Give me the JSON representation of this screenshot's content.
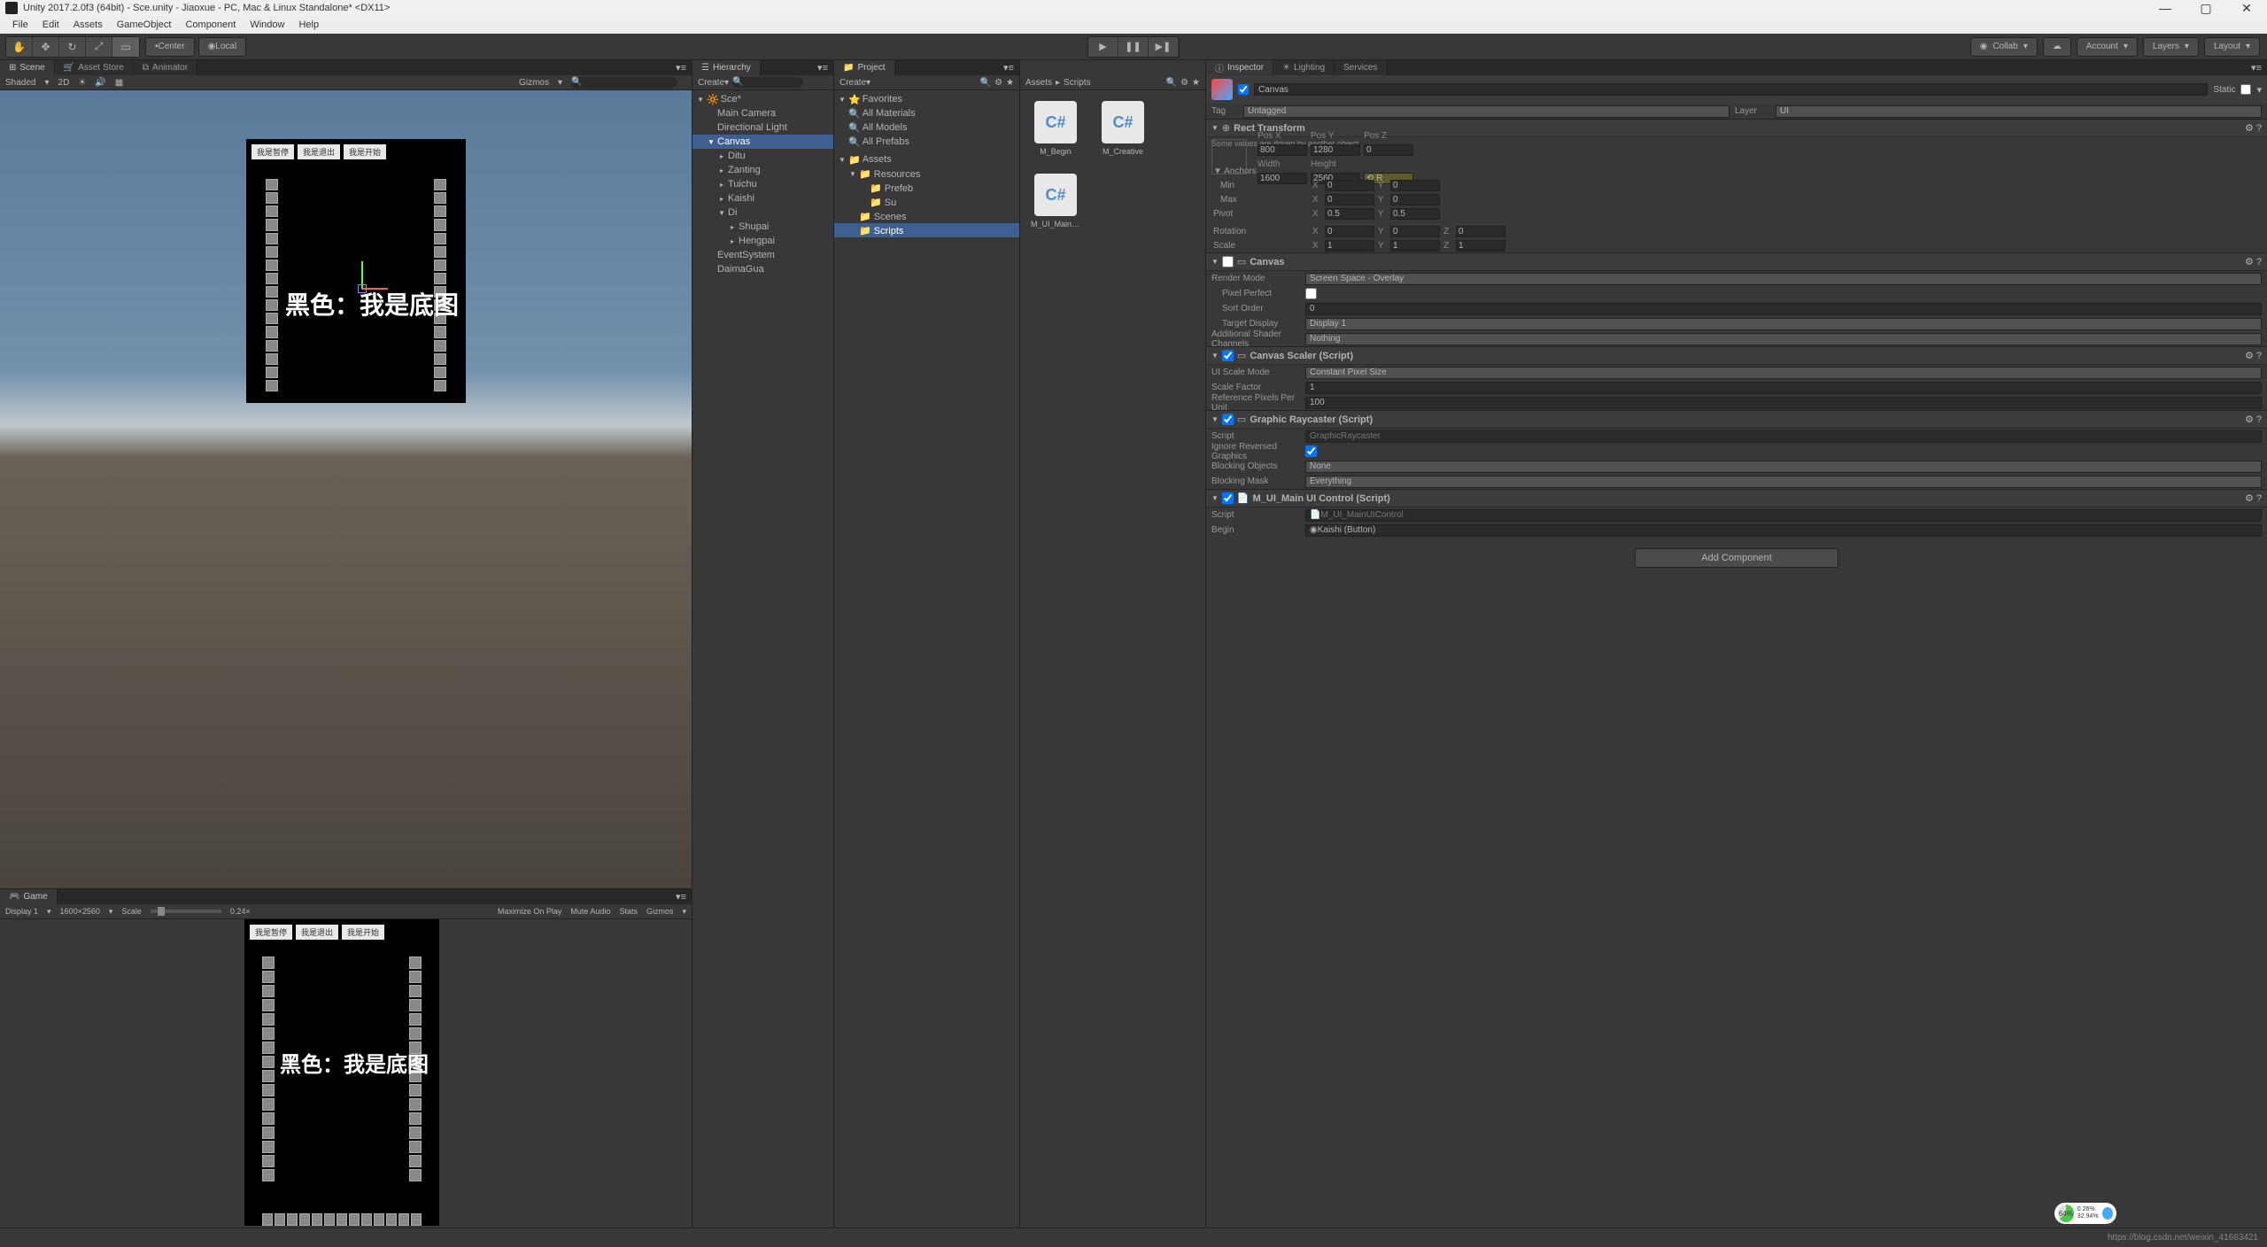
{
  "title": "Unity 2017.2.0f3 (64bit) - Sce.unity - Jiaoxue - PC, Mac & Linux Standalone* <DX11>",
  "menu": [
    "File",
    "Edit",
    "Assets",
    "GameObject",
    "Component",
    "Window",
    "Help"
  ],
  "toolbar": {
    "center": "Center",
    "local": "Local",
    "collab": "Collab",
    "account": "Account",
    "layers": "Layers",
    "layout": "Layout"
  },
  "tabs": {
    "scene": "Scene",
    "asset_store": "Asset Store",
    "animator": "Animator",
    "game": "Game",
    "hierarchy": "Hierarchy",
    "project": "Project",
    "inspector": "Inspector",
    "lighting": "Lighting",
    "services": "Services"
  },
  "scene_toolbar": {
    "shaded": "Shaded",
    "mode": "2D",
    "gizmos": "Gizmos"
  },
  "scene_buttons": [
    "我是暂停",
    "我是退出",
    "我是开始"
  ],
  "scene_text": "黑色：我是底图",
  "game_toolbar": {
    "display": "Display 1",
    "resolution": "1600×2560",
    "scale_label": "Scale",
    "scale_value": "0.24×",
    "maximize": "Maximize On Play",
    "mute": "Mute Audio",
    "stats": "Stats",
    "gizmos": "Gizmos"
  },
  "game_buttons": [
    "我是暂停",
    "我是退出",
    "我是开始"
  ],
  "game_text": "黑色：我是底图",
  "hierarchy": {
    "create": "Create",
    "scene_name": "Sce*",
    "items": [
      {
        "name": "Main Camera",
        "indent": 1
      },
      {
        "name": "Directional Light",
        "indent": 1
      },
      {
        "name": "Canvas",
        "indent": 1,
        "expanded": true,
        "selected": true
      },
      {
        "name": "Ditu",
        "indent": 2,
        "arrow": true
      },
      {
        "name": "Zanting",
        "indent": 2,
        "arrow": true
      },
      {
        "name": "Tuichu",
        "indent": 2,
        "arrow": true
      },
      {
        "name": "Kaishi",
        "indent": 2,
        "arrow": true
      },
      {
        "name": "Di",
        "indent": 2,
        "expanded": true
      },
      {
        "name": "Shupai",
        "indent": 3,
        "arrow": true
      },
      {
        "name": "Hengpai",
        "indent": 3,
        "arrow": true
      },
      {
        "name": "EventSystem",
        "indent": 1
      },
      {
        "name": "DaimaGua",
        "indent": 1
      }
    ]
  },
  "project": {
    "create": "Create",
    "favorites": "Favorites",
    "fav_items": [
      "All Materials",
      "All Models",
      "All Prefabs"
    ],
    "assets": "Assets",
    "folders": [
      {
        "name": "Resources",
        "indent": 1,
        "expanded": true
      },
      {
        "name": "Prefeb",
        "indent": 2
      },
      {
        "name": "Su",
        "indent": 2
      },
      {
        "name": "Scenes",
        "indent": 1
      },
      {
        "name": "Scripts",
        "indent": 1,
        "selected": true
      }
    ],
    "breadcrumb": [
      "Assets",
      "Scripts"
    ],
    "files": [
      "M_Begin",
      "M_Creative",
      "M_UI_MainUIC.."
    ]
  },
  "inspector": {
    "static": "Static",
    "name": "Canvas",
    "tag_label": "Tag",
    "tag": "Untagged",
    "layer_label": "Layer",
    "layer": "UI",
    "rect_transform": {
      "title": "Rect Transform",
      "note": "Some values are driven by another object.",
      "pos_x_label": "Pos X",
      "pos_x": "800",
      "pos_y_label": "Pos Y",
      "pos_y": "1280",
      "pos_z_label": "Pos Z",
      "pos_z": "0",
      "width_label": "Width",
      "width": "1600",
      "height_label": "Height",
      "height": "2560",
      "anchors": "Anchors",
      "min": "Min",
      "min_x": "0",
      "min_y": "0",
      "max": "Max",
      "max_x": "0",
      "max_y": "0",
      "pivot": "Pivot",
      "pivot_x": "0.5",
      "pivot_y": "0.5",
      "rotation": "Rotation",
      "rot_x": "0",
      "rot_y": "0",
      "rot_z": "0",
      "scale": "Scale",
      "scale_x": "1",
      "scale_y": "1",
      "scale_z": "1"
    },
    "canvas": {
      "title": "Canvas",
      "render_mode_label": "Render Mode",
      "render_mode": "Screen Space - Overlay",
      "pixel_perfect": "Pixel Perfect",
      "sort_order_label": "Sort Order",
      "sort_order": "0",
      "target_display_label": "Target Display",
      "target_display": "Display 1",
      "shader_channels_label": "Additional Shader Channels",
      "shader_channels": "Nothing"
    },
    "canvas_scaler": {
      "title": "Canvas Scaler (Script)",
      "ui_scale_mode_label": "UI Scale Mode",
      "ui_scale_mode": "Constant Pixel Size",
      "scale_factor_label": "Scale Factor",
      "scale_factor": "1",
      "ref_pixels_label": "Reference Pixels Per Unit",
      "ref_pixels": "100"
    },
    "graphic_raycaster": {
      "title": "Graphic Raycaster (Script)",
      "script_label": "Script",
      "script": "GraphicRaycaster",
      "ignore_reversed": "Ignore Reversed Graphics",
      "blocking_objects_label": "Blocking Objects",
      "blocking_objects": "None",
      "blocking_mask_label": "Blocking Mask",
      "blocking_mask": "Everything"
    },
    "main_ui_control": {
      "title": "M_UI_Main UI Control (Script)",
      "script_label": "Script",
      "script": "M_UI_MainUIControl",
      "begin_label": "Begin",
      "begin": "Kaishi (Button)"
    },
    "add_component": "Add Component"
  },
  "status": {
    "url": "https://blog.csdn.net/weixin_41663421",
    "perf_pct": "64%",
    "perf_a": "0.26%",
    "perf_b": "32.94%"
  }
}
